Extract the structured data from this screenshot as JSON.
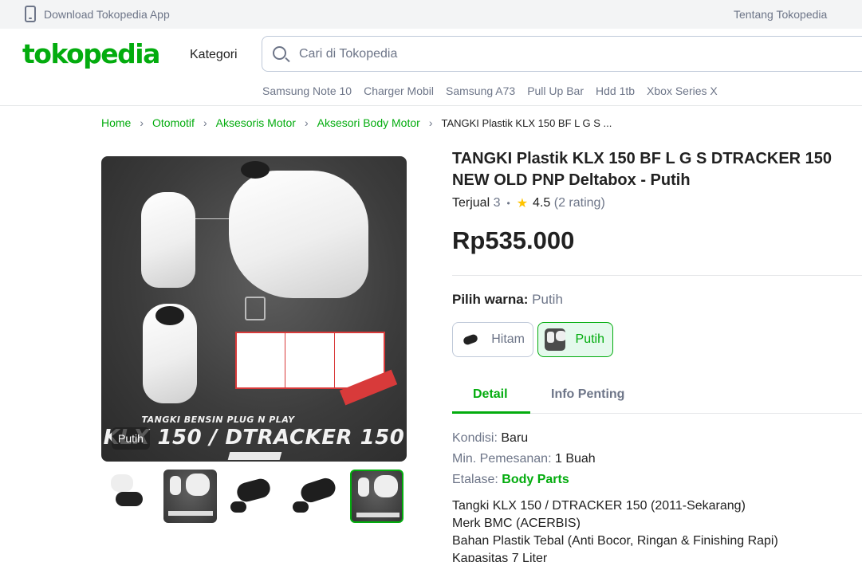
{
  "topbar": {
    "download_label": "Download Tokopedia App",
    "about_label": "Tentang Tokopedia"
  },
  "header": {
    "logo_text": "tokopedia",
    "kategori_label": "Kategori",
    "search_placeholder": "Cari di Tokopedia",
    "search_value": "",
    "keywords": [
      "Samsung Note 10",
      "Charger Mobil",
      "Samsung A73",
      "Pull Up Bar",
      "Hdd 1tb",
      "Xbox Series X"
    ]
  },
  "breadcrumb": {
    "items": [
      "Home",
      "Otomotif",
      "Aksesoris Motor",
      "Aksesori Body Motor"
    ],
    "current": "TANGKI Plastik KLX 150 BF L G S ..."
  },
  "gallery": {
    "main_caption_sub": "TANGKI BENSIN PLUG N PLAY",
    "main_caption": "KLX 150 / DTRACKER 150",
    "variant_badge": "Putih",
    "thumbnail_count": 5,
    "active_thumbnail": 5
  },
  "product": {
    "title": "TANGKI Plastik KLX 150 BF L G S DTRACKER 150 NEW OLD PNP Deltabox - Putih",
    "sold_label": "Terjual",
    "sold_count": "3",
    "rating": "4.5",
    "rating_count": "(2 rating)",
    "price": "Rp535.000",
    "variant_label": "Pilih warna:",
    "variant_selected": "Putih",
    "variants": [
      {
        "label": "Hitam",
        "selected": false
      },
      {
        "label": "Putih",
        "selected": true
      }
    ]
  },
  "tabs": {
    "detail": "Detail",
    "info": "Info Penting",
    "active": "Detail"
  },
  "specs": {
    "kondisi_label": "Kondisi:",
    "kondisi_value": "Baru",
    "min_label": "Min. Pemesanan:",
    "min_value": "1 Buah",
    "etalase_label": "Etalase:",
    "etalase_value": "Body Parts"
  },
  "description": [
    "Tangki KLX 150 / DTRACKER 150 (2011-Sekarang)",
    "Merk BMC (ACERBIS)",
    "Bahan Plastik Tebal (Anti Bocor, Ringan & Finishing Rapi)",
    "Kapasitas 7 Liter"
  ],
  "colors": {
    "brand_green": "#03ac0e",
    "text_primary": "#212121",
    "text_secondary": "#6d7588",
    "star": "#ffc400"
  },
  "icons": [
    "phone-icon",
    "search-icon",
    "chevron-right-icon",
    "star-icon"
  ]
}
